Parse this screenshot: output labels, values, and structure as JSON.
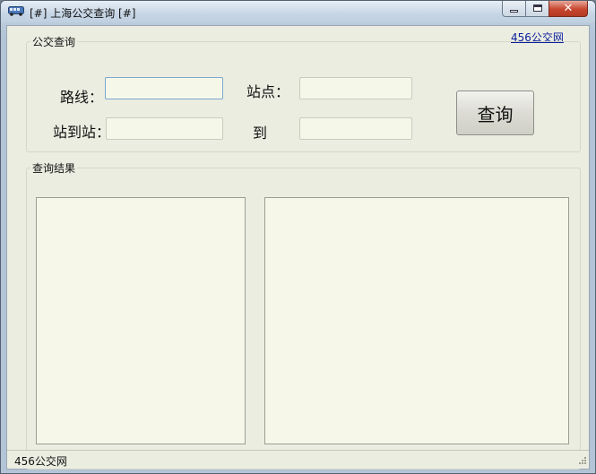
{
  "window": {
    "title": "[#] 上海公交查询 [#]",
    "close_glyph": "✕"
  },
  "top_link": "456公交网",
  "search_group": {
    "legend": "公交查询",
    "route_label": "路线：",
    "route_value": "",
    "station_label": "站点：",
    "station_value": "",
    "from_label": "站到站：",
    "from_value": "",
    "to_label": "到",
    "to_value": "",
    "query_button": "查询"
  },
  "result_group": {
    "legend": "查询结果"
  },
  "statusbar": {
    "text": "456公交网"
  },
  "colors": {
    "background": "#ecede1",
    "input_background": "#f5f7e8",
    "link": "#0a1f9c",
    "close_button": "#c8462e"
  },
  "icons": {
    "app": "bus-icon",
    "minimize": "minimize-icon",
    "maximize": "maximize-icon",
    "close": "close-icon",
    "resize": "resize-grip-icon"
  }
}
